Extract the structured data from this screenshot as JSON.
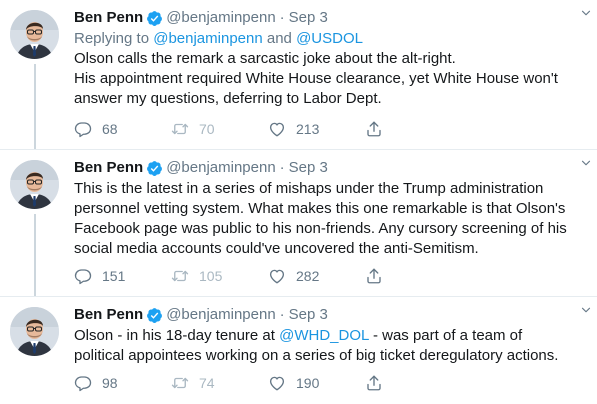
{
  "tweets": [
    {
      "author": {
        "name": "Ben Penn",
        "handle": "@benjaminpenn",
        "verified": true
      },
      "date": "Sep 3",
      "reply_prefix": "Replying to",
      "reply_mention_1": "@benjaminpenn",
      "reply_and": "and",
      "reply_mention_2": "@USDOL",
      "lines": [
        "Olson calls the remark a sarcastic joke about the alt-right.",
        "His appointment required White House clearance, yet White House won't",
        "answer my questions, deferring to Labor Dept."
      ],
      "stats": {
        "replies": "68",
        "retweets": "70",
        "likes": "213"
      }
    },
    {
      "author": {
        "name": "Ben Penn",
        "handle": "@benjaminpenn",
        "verified": true
      },
      "date": "Sep 3",
      "lines": [
        "This is the latest in a series of mishaps under the Trump administration",
        "personnel vetting system. What makes this one remarkable is that Olson's",
        "Facebook page was public to his non-friends. Any cursory screening of his",
        "social media accounts could've uncovered the anti-Semitism."
      ],
      "stats": {
        "replies": "151",
        "retweets": "105",
        "likes": "282"
      }
    },
    {
      "author": {
        "name": "Ben Penn",
        "handle": "@benjaminpenn",
        "verified": true
      },
      "date": "Sep 3",
      "line1_pre": "Olson - in his 18-day tenure at ",
      "line1_link": "@WHD_DOL",
      "line1_post": " - was part of a team of",
      "line2": "political appointees working on a series of big ticket deregulatory actions.",
      "stats": {
        "replies": "98",
        "retweets": "74",
        "likes": "190"
      }
    }
  ],
  "separator": "·",
  "colors": {
    "link": "#1b95e0",
    "muted": "#657786",
    "verified": "#1da1f2",
    "divider": "#e6ecf0"
  },
  "icons": [
    "verified-badge-icon",
    "caret-down-icon",
    "reply-icon",
    "retweet-icon",
    "like-icon",
    "share-icon"
  ]
}
